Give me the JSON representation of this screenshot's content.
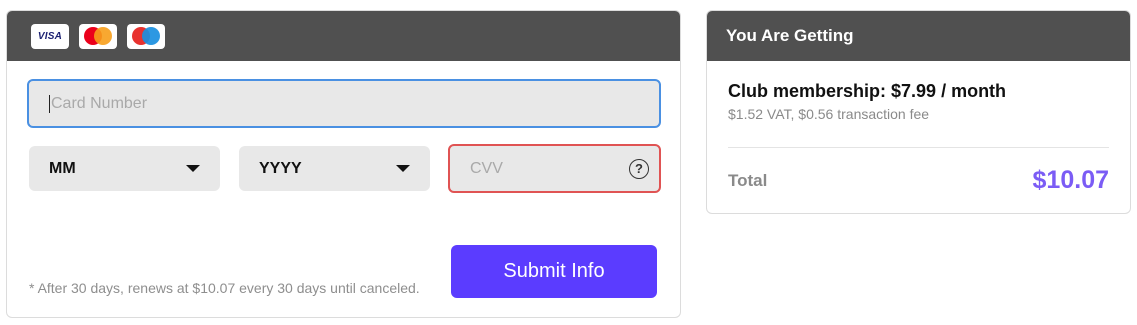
{
  "payment": {
    "card_logos": [
      {
        "name": "visa-icon",
        "text": "VISA"
      },
      {
        "name": "mastercard-icon"
      },
      {
        "name": "maestro-icon"
      }
    ],
    "card_number": {
      "placeholder": "Card Number",
      "value": ""
    },
    "month": {
      "selected": "MM"
    },
    "year": {
      "selected": "YYYY"
    },
    "cvv": {
      "placeholder": "CVV",
      "value": "",
      "help_glyph": "?"
    },
    "renew_note": "* After 30 days, renews at $10.07 every 30 days until canceled.",
    "submit_label": "Submit Info",
    "colors": {
      "accent": "#5b3cff",
      "focus_border": "#4a90e2",
      "error_border": "#e05353",
      "header_bg": "#505050"
    }
  },
  "summary": {
    "header": "You Are Getting",
    "item_name": "Club membership: $7.99 / month",
    "item_sub": "$1.52 VAT, $0.56 transaction fee",
    "total_label": "Total",
    "total_value": "$10.07",
    "colors": {
      "total": "#7b5cf5"
    }
  }
}
